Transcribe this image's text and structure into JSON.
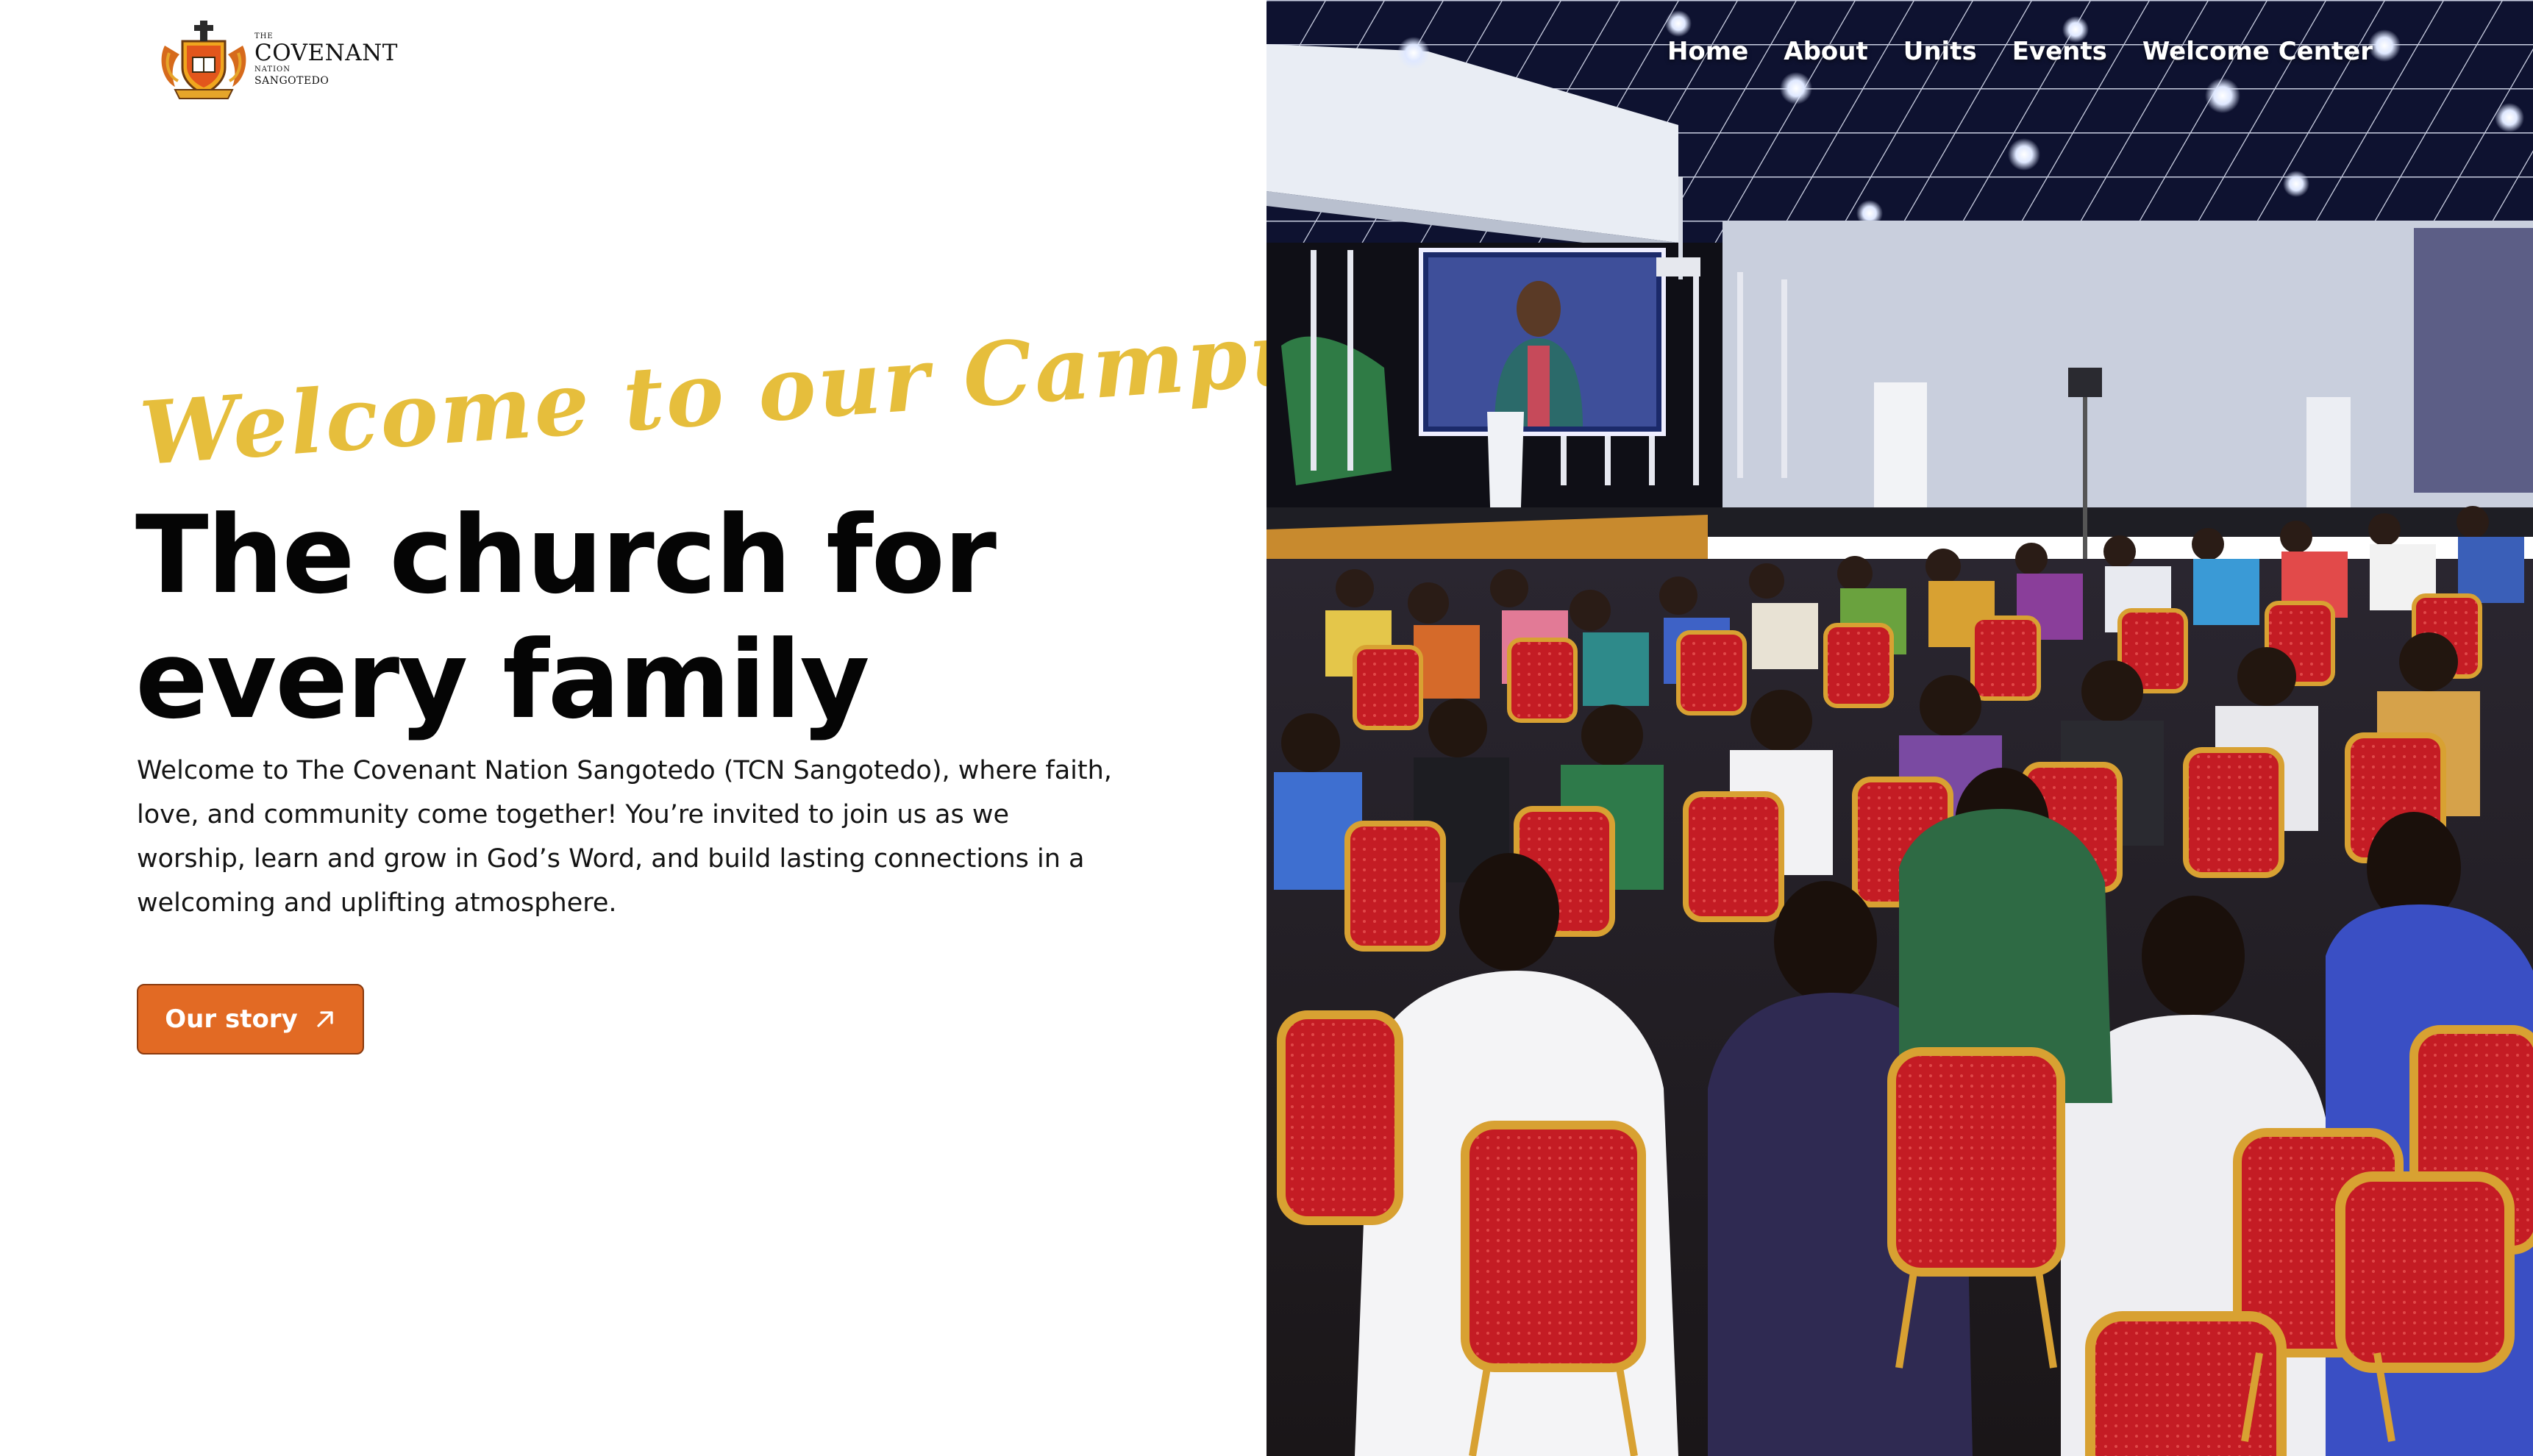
{
  "logo": {
    "the_label": "THE",
    "name_line1": "COVENANT",
    "name_line2": "NATION",
    "name_line3": "SANGOTEDO"
  },
  "nav": {
    "items": [
      {
        "label": "Home"
      },
      {
        "label": "About"
      },
      {
        "label": "Units"
      },
      {
        "label": "Events"
      },
      {
        "label": "Welcome Center"
      }
    ]
  },
  "hero": {
    "script_title": "Welcome to our Campus",
    "headline_line1": "The church for",
    "headline_line2": "every family",
    "intro": "Welcome to The Covenant Nation Sangotedo (TCN Sangotedo), where faith, love, and community come together! You’re invited to join us as we worship, learn and grow in God’s Word, and build lasting connections in a welcoming and uplifting atmosphere.",
    "cta_label": "Our story",
    "cta_icon": "arrow-up-right-icon"
  },
  "colors": {
    "accent_orange": "#e26a24",
    "script_yellow": "#e6be3c",
    "headline": "#050505",
    "nav_text": "#ffffff",
    "chair_red": "#c41c24",
    "chair_gold": "#d8a132"
  }
}
